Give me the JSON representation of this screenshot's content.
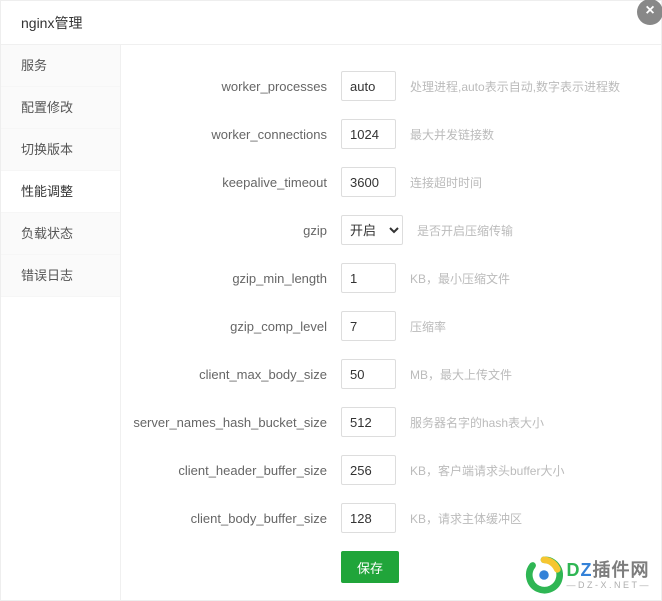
{
  "title": "nginx管理",
  "close_glyph": "×",
  "sidebar": {
    "items": [
      {
        "label": "服务"
      },
      {
        "label": "配置修改"
      },
      {
        "label": "切换版本"
      },
      {
        "label": "性能调整"
      },
      {
        "label": "负载状态"
      },
      {
        "label": "错误日志"
      }
    ],
    "active_index": 3
  },
  "form": {
    "rows": [
      {
        "label": "worker_processes",
        "value": "auto",
        "hint": "处理进程,auto表示自动,数字表示进程数",
        "type": "text"
      },
      {
        "label": "worker_connections",
        "value": "1024",
        "hint": "最大并发链接数",
        "type": "text"
      },
      {
        "label": "keepalive_timeout",
        "value": "3600",
        "hint": "连接超时时间",
        "type": "text"
      },
      {
        "label": "gzip",
        "value": "开启",
        "hint": "是否开启压缩传输",
        "type": "select"
      },
      {
        "label": "gzip_min_length",
        "value": "1",
        "hint": "KB，最小压缩文件",
        "type": "text"
      },
      {
        "label": "gzip_comp_level",
        "value": "7",
        "hint": "压缩率",
        "type": "text"
      },
      {
        "label": "client_max_body_size",
        "value": "50",
        "hint": "MB，最大上传文件",
        "type": "text"
      },
      {
        "label": "server_names_hash_bucket_size",
        "value": "512",
        "hint": "服务器名字的hash表大小",
        "type": "text"
      },
      {
        "label": "client_header_buffer_size",
        "value": "256",
        "hint": "KB，客户端请求头buffer大小",
        "type": "text"
      },
      {
        "label": "client_body_buffer_size",
        "value": "128",
        "hint": "KB，请求主体缓冲区",
        "type": "text"
      }
    ],
    "save_label": "保存"
  },
  "watermark": {
    "main_d": "D",
    "main_z": "Z",
    "main_rest": "插件网",
    "sub": "—DZ-X.NET—"
  }
}
